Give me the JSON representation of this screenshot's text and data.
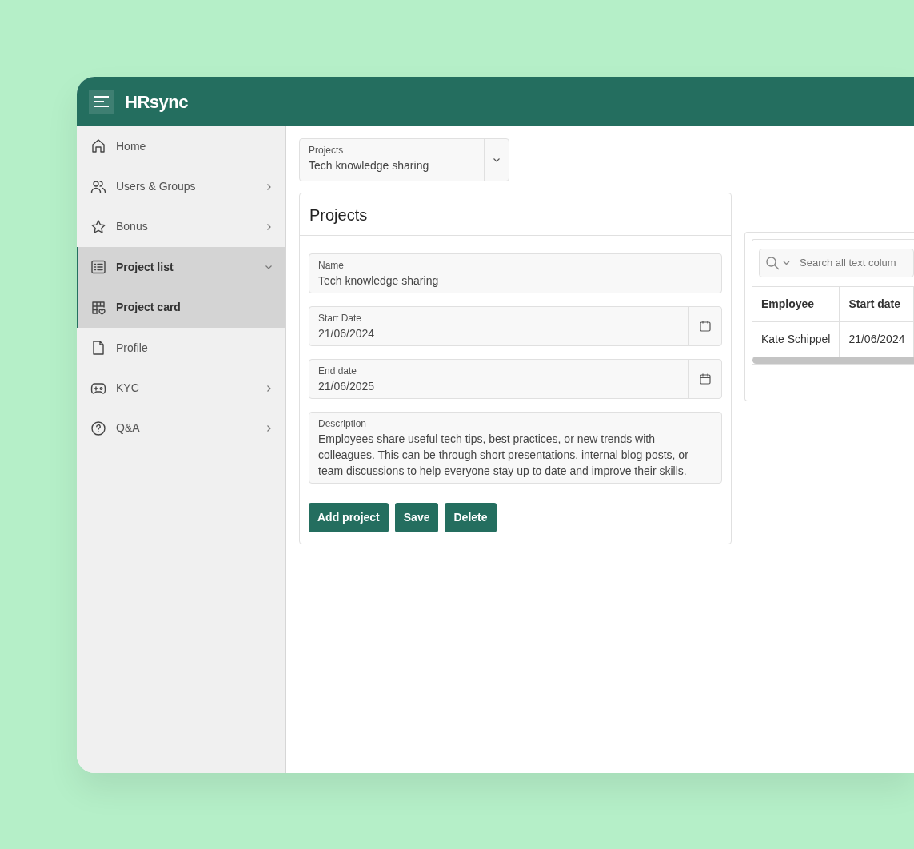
{
  "app": {
    "logo": "HRsync"
  },
  "sidebar": {
    "items": [
      {
        "label": "Home",
        "has_submenu": false,
        "selected": false
      },
      {
        "label": "Users & Groups",
        "has_submenu": true,
        "selected": false
      },
      {
        "label": "Bonus",
        "has_submenu": true,
        "selected": false
      },
      {
        "label": "Project list",
        "has_submenu": true,
        "expanded": true,
        "selected": true,
        "children": [
          {
            "label": "Project card",
            "has_submenu": false,
            "selected": true
          }
        ]
      },
      {
        "label": "Profile",
        "has_submenu": false,
        "selected": false
      },
      {
        "label": "KYC",
        "has_submenu": true,
        "selected": false
      },
      {
        "label": "Q&A",
        "has_submenu": true,
        "selected": false
      }
    ]
  },
  "project_select": {
    "label": "Projects",
    "value": "Tech knowledge sharing"
  },
  "form": {
    "title": "Projects",
    "fields": [
      {
        "kind": "text",
        "label": "Name",
        "value": "Tech knowledge sharing"
      },
      {
        "kind": "date",
        "label": "Start Date",
        "value": "21/06/2024"
      },
      {
        "kind": "date",
        "label": "End date",
        "value": "21/06/2025"
      },
      {
        "kind": "textarea",
        "label": "Description",
        "value": "Employees share useful tech tips, best practices, or new trends with colleagues. This can be through short presentations, internal blog posts, or team discussions to help everyone stay up to date and improve their skills."
      }
    ],
    "buttons": [
      "Add project",
      "Save",
      "Delete"
    ]
  },
  "table": {
    "search": {
      "placeholder": "Search all text colum"
    },
    "columns": [
      "Employee",
      "Start date"
    ],
    "rows": [
      [
        "Kate Schippel",
        "21/06/2024"
      ]
    ]
  }
}
